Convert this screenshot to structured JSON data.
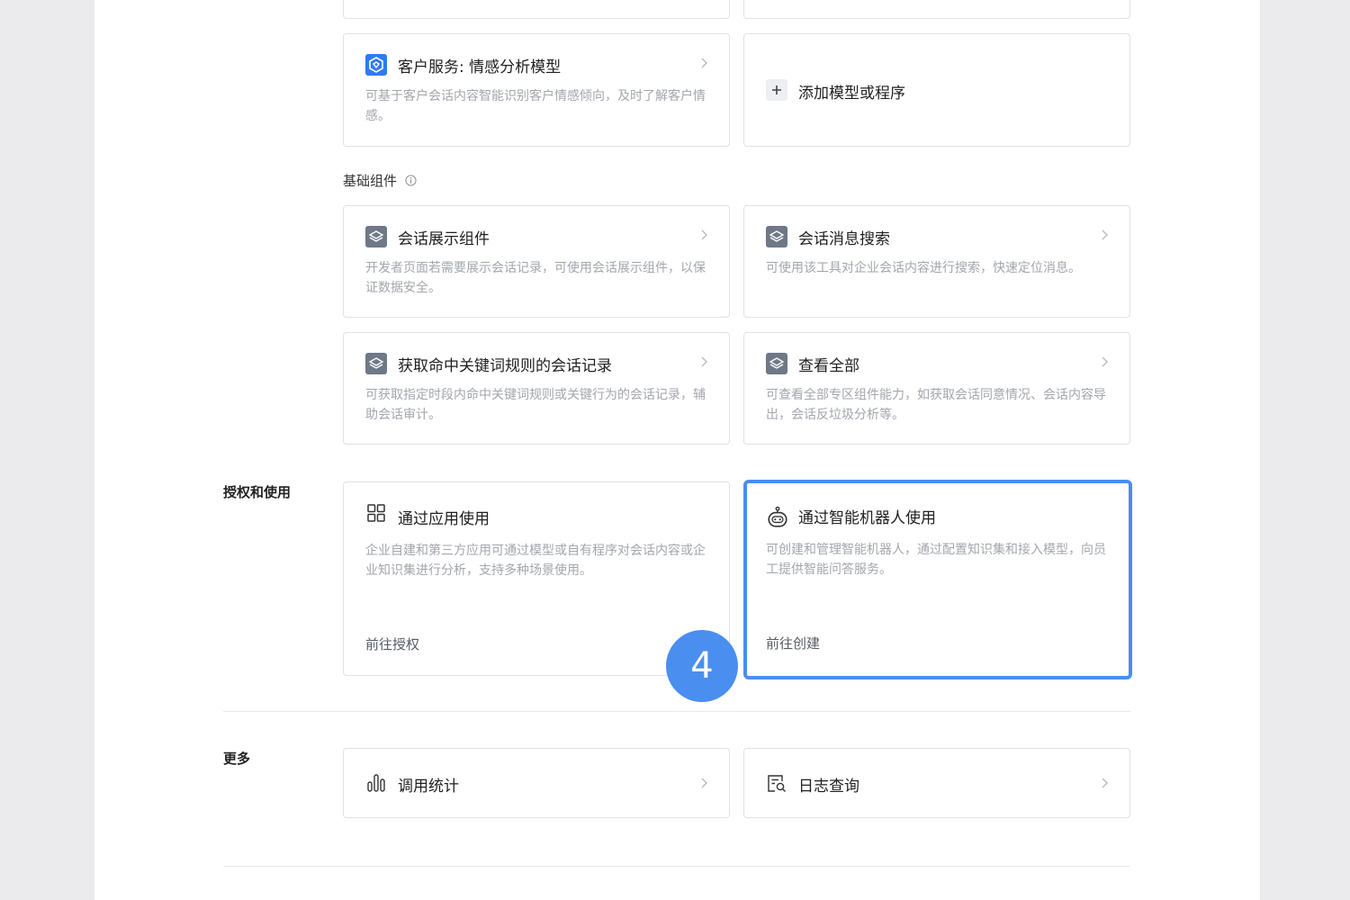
{
  "sections": {
    "basic_components": "基础组件",
    "auth_usage": "授权和使用",
    "more": "更多"
  },
  "cards": {
    "customer_service": {
      "title": "客户服务: 情感分析模型",
      "desc": "可基于客户会话内容智能识别客户情感倾向，及时了解客户情感。"
    },
    "add_model": {
      "title": "添加模型或程序"
    },
    "chat_display": {
      "title": "会话展示组件",
      "desc": "开发者页面若需要展示会话记录，可使用会话展示组件，以保证数据安全。"
    },
    "message_search": {
      "title": "会话消息搜索",
      "desc": "可使用该工具对企业会话内容进行搜索，快速定位消息。"
    },
    "keyword_records": {
      "title": "获取命中关键词规则的会话记录",
      "desc": "可获取指定时段内命中关键词规则或关键行为的会话记录，辅助会话审计。"
    },
    "view_all": {
      "title": "查看全部",
      "desc": "可查看全部专区组件能力，如获取会话同意情况、会话内容导出，会话反垃圾分析等。"
    },
    "via_app": {
      "title": "通过应用使用",
      "desc": "企业自建和第三方应用可通过模型或自有程序对会话内容或企业知识集进行分析，支持多种场景使用。",
      "link": "前往授权"
    },
    "via_robot": {
      "title": "通过智能机器人使用",
      "desc": "可创建和管理智能机器人，通过配置知识集和接入模型，向员工提供智能问答服务。",
      "link": "前往创建"
    },
    "call_stats": {
      "title": "调用统计"
    },
    "log_query": {
      "title": "日志查询"
    }
  },
  "step_badge": "4",
  "colors": {
    "accent": "#4a8ef0",
    "muted_text": "#a3a6ad",
    "border": "#e1e2e6"
  }
}
